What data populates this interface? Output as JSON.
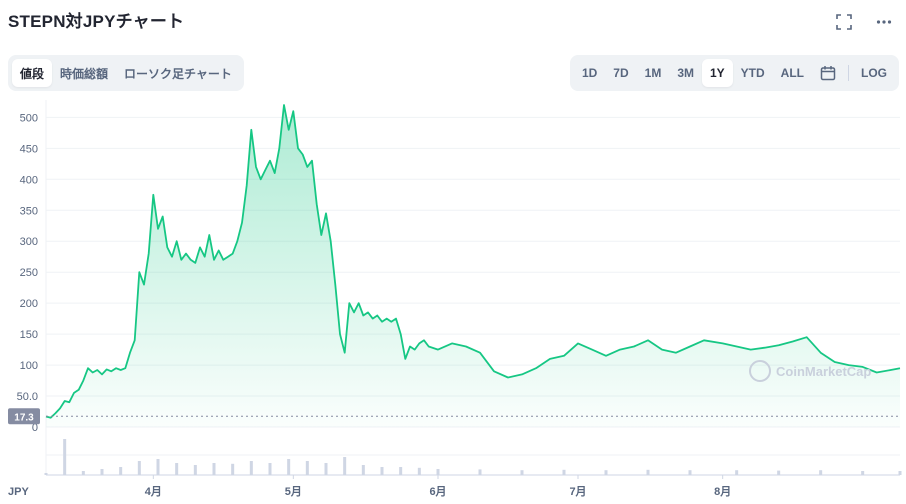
{
  "header": {
    "title": "STEPN対JPYチャート",
    "icons": [
      "fullscreen-icon",
      "more-icon"
    ]
  },
  "view_tabs": [
    {
      "label": "値段",
      "active": true
    },
    {
      "label": "時価総額",
      "active": false
    },
    {
      "label": "ローソク足チャート",
      "active": false
    }
  ],
  "range_tabs": [
    {
      "label": "1D",
      "active": false
    },
    {
      "label": "7D",
      "active": false
    },
    {
      "label": "1M",
      "active": false
    },
    {
      "label": "3M",
      "active": false
    },
    {
      "label": "1Y",
      "active": true
    },
    {
      "label": "YTD",
      "active": false
    },
    {
      "label": "ALL",
      "active": false
    }
  ],
  "log_label": "LOG",
  "watermark": "CoinMarketCap",
  "colors": {
    "line": "#16c784",
    "fill_top": "#16c784",
    "grid": "#eff2f5",
    "badge": "#858ca2"
  },
  "chart_data": {
    "type": "area",
    "currency_label": "JPY",
    "y_ticks": [
      50.0,
      100,
      150,
      200,
      250,
      300,
      350,
      400,
      450,
      500
    ],
    "y_tick_labels": [
      "50.0",
      "100",
      "150",
      "200",
      "250",
      "300",
      "350",
      "400",
      "450",
      "500"
    ],
    "y_zero_label": "0",
    "ylim": [
      0,
      520
    ],
    "x_month_labels": [
      "4月",
      "5月",
      "6月",
      "7月",
      "8月"
    ],
    "current_value_label": "17.3",
    "current_value": 17.3,
    "series": [
      {
        "points": [
          [
            "2022-03-09",
            17
          ],
          [
            "2022-03-10",
            15
          ],
          [
            "2022-03-11",
            22
          ],
          [
            "2022-03-12",
            30
          ],
          [
            "2022-03-13",
            42
          ],
          [
            "2022-03-14",
            40
          ],
          [
            "2022-03-15",
            55
          ],
          [
            "2022-03-16",
            60
          ],
          [
            "2022-03-17",
            75
          ],
          [
            "2022-03-18",
            95
          ],
          [
            "2022-03-19",
            88
          ],
          [
            "2022-03-20",
            92
          ],
          [
            "2022-03-21",
            85
          ],
          [
            "2022-03-22",
            93
          ],
          [
            "2022-03-23",
            90
          ],
          [
            "2022-03-24",
            95
          ],
          [
            "2022-03-25",
            92
          ],
          [
            "2022-03-26",
            95
          ],
          [
            "2022-03-27",
            120
          ],
          [
            "2022-03-28",
            140
          ],
          [
            "2022-03-29",
            250
          ],
          [
            "2022-03-30",
            230
          ],
          [
            "2022-03-31",
            280
          ],
          [
            "2022-04-01",
            375
          ],
          [
            "2022-04-02",
            320
          ],
          [
            "2022-04-03",
            340
          ],
          [
            "2022-04-04",
            290
          ],
          [
            "2022-04-05",
            275
          ],
          [
            "2022-04-06",
            300
          ],
          [
            "2022-04-07",
            270
          ],
          [
            "2022-04-08",
            280
          ],
          [
            "2022-04-09",
            270
          ],
          [
            "2022-04-10",
            265
          ],
          [
            "2022-04-11",
            290
          ],
          [
            "2022-04-12",
            275
          ],
          [
            "2022-04-13",
            310
          ],
          [
            "2022-04-14",
            270
          ],
          [
            "2022-04-15",
            285
          ],
          [
            "2022-04-16",
            270
          ],
          [
            "2022-04-17",
            275
          ],
          [
            "2022-04-18",
            280
          ],
          [
            "2022-04-19",
            300
          ],
          [
            "2022-04-20",
            330
          ],
          [
            "2022-04-21",
            390
          ],
          [
            "2022-04-22",
            480
          ],
          [
            "2022-04-23",
            420
          ],
          [
            "2022-04-24",
            400
          ],
          [
            "2022-04-25",
            415
          ],
          [
            "2022-04-26",
            430
          ],
          [
            "2022-04-27",
            410
          ],
          [
            "2022-04-28",
            450
          ],
          [
            "2022-04-29",
            520
          ],
          [
            "2022-04-30",
            480
          ],
          [
            "2022-05-01",
            510
          ],
          [
            "2022-05-02",
            450
          ],
          [
            "2022-05-03",
            440
          ],
          [
            "2022-05-04",
            420
          ],
          [
            "2022-05-05",
            430
          ],
          [
            "2022-05-06",
            360
          ],
          [
            "2022-05-07",
            310
          ],
          [
            "2022-05-08",
            345
          ],
          [
            "2022-05-09",
            300
          ],
          [
            "2022-05-10",
            230
          ],
          [
            "2022-05-11",
            150
          ],
          [
            "2022-05-12",
            120
          ],
          [
            "2022-05-13",
            200
          ],
          [
            "2022-05-14",
            185
          ],
          [
            "2022-05-15",
            200
          ],
          [
            "2022-05-16",
            180
          ],
          [
            "2022-05-17",
            185
          ],
          [
            "2022-05-18",
            175
          ],
          [
            "2022-05-19",
            180
          ],
          [
            "2022-05-20",
            170
          ],
          [
            "2022-05-21",
            175
          ],
          [
            "2022-05-22",
            170
          ],
          [
            "2022-05-23",
            175
          ],
          [
            "2022-05-24",
            150
          ],
          [
            "2022-05-25",
            110
          ],
          [
            "2022-05-26",
            130
          ],
          [
            "2022-05-27",
            125
          ],
          [
            "2022-05-28",
            135
          ],
          [
            "2022-05-29",
            140
          ],
          [
            "2022-05-30",
            130
          ],
          [
            "2022-06-01",
            125
          ],
          [
            "2022-06-04",
            135
          ],
          [
            "2022-06-07",
            130
          ],
          [
            "2022-06-10",
            120
          ],
          [
            "2022-06-13",
            90
          ],
          [
            "2022-06-16",
            80
          ],
          [
            "2022-06-19",
            85
          ],
          [
            "2022-06-22",
            95
          ],
          [
            "2022-06-25",
            110
          ],
          [
            "2022-06-28",
            115
          ],
          [
            "2022-07-01",
            135
          ],
          [
            "2022-07-04",
            125
          ],
          [
            "2022-07-07",
            115
          ],
          [
            "2022-07-10",
            125
          ],
          [
            "2022-07-13",
            130
          ],
          [
            "2022-07-16",
            140
          ],
          [
            "2022-07-19",
            125
          ],
          [
            "2022-07-22",
            120
          ],
          [
            "2022-07-25",
            130
          ],
          [
            "2022-07-28",
            140
          ],
          [
            "2022-08-01",
            135
          ],
          [
            "2022-08-04",
            130
          ],
          [
            "2022-08-07",
            125
          ],
          [
            "2022-08-10",
            128
          ],
          [
            "2022-08-13",
            132
          ],
          [
            "2022-08-16",
            138
          ],
          [
            "2022-08-19",
            145
          ],
          [
            "2022-08-22",
            120
          ],
          [
            "2022-08-25",
            105
          ],
          [
            "2022-08-28",
            100
          ],
          [
            "2022-08-31",
            97
          ],
          [
            "2022-09-03",
            88
          ],
          [
            "2022-09-06",
            92
          ],
          [
            "2022-09-08",
            95
          ]
        ]
      }
    ],
    "volume_series": [
      [
        "2022-03-09",
        0.05
      ],
      [
        "2022-03-13",
        0.9
      ],
      [
        "2022-03-17",
        0.1
      ],
      [
        "2022-03-21",
        0.15
      ],
      [
        "2022-03-25",
        0.2
      ],
      [
        "2022-03-29",
        0.35
      ],
      [
        "2022-04-02",
        0.4
      ],
      [
        "2022-04-06",
        0.3
      ],
      [
        "2022-04-10",
        0.25
      ],
      [
        "2022-04-14",
        0.3
      ],
      [
        "2022-04-18",
        0.28
      ],
      [
        "2022-04-22",
        0.35
      ],
      [
        "2022-04-26",
        0.3
      ],
      [
        "2022-04-30",
        0.4
      ],
      [
        "2022-05-04",
        0.35
      ],
      [
        "2022-05-08",
        0.3
      ],
      [
        "2022-05-12",
        0.45
      ],
      [
        "2022-05-16",
        0.25
      ],
      [
        "2022-05-20",
        0.2
      ],
      [
        "2022-05-24",
        0.2
      ],
      [
        "2022-05-28",
        0.18
      ],
      [
        "2022-06-01",
        0.15
      ],
      [
        "2022-06-10",
        0.14
      ],
      [
        "2022-06-19",
        0.12
      ],
      [
        "2022-06-28",
        0.13
      ],
      [
        "2022-07-07",
        0.12
      ],
      [
        "2022-07-16",
        0.13
      ],
      [
        "2022-07-25",
        0.12
      ],
      [
        "2022-08-04",
        0.12
      ],
      [
        "2022-08-13",
        0.11
      ],
      [
        "2022-08-22",
        0.12
      ],
      [
        "2022-08-31",
        0.1
      ],
      [
        "2022-09-08",
        0.1
      ]
    ],
    "grid": true
  }
}
